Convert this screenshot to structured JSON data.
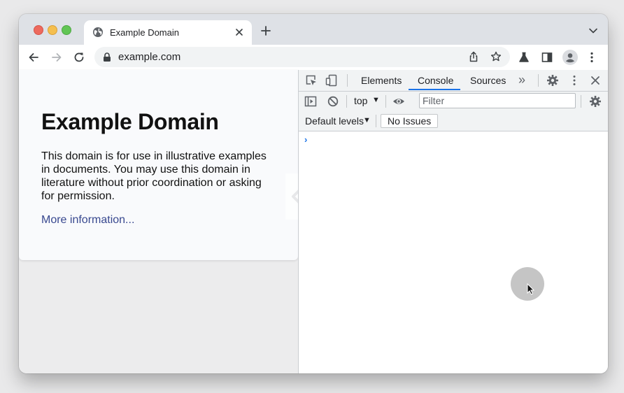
{
  "browser": {
    "tab": {
      "title": "Example Domain"
    },
    "address": {
      "url": "example.com"
    }
  },
  "page": {
    "heading": "Example Domain",
    "paragraph": "This domain is for use in illustrative examples in documents. You may use this domain in literature without prior coordination or asking for permission.",
    "link": "More information..."
  },
  "devtools": {
    "tabs": [
      "Elements",
      "Console",
      "Sources"
    ],
    "active_tab": "Console",
    "more_tabs": "»",
    "context": "top",
    "filter_placeholder": "Filter",
    "levels": "Default levels",
    "issues": "No Issues",
    "prompt": "›"
  },
  "colors": {
    "accent": "#1a73e8",
    "link": "#38488f",
    "traffic_red": "#ed6a5e",
    "traffic_yellow": "#f5bf4f",
    "traffic_green": "#61c554"
  }
}
